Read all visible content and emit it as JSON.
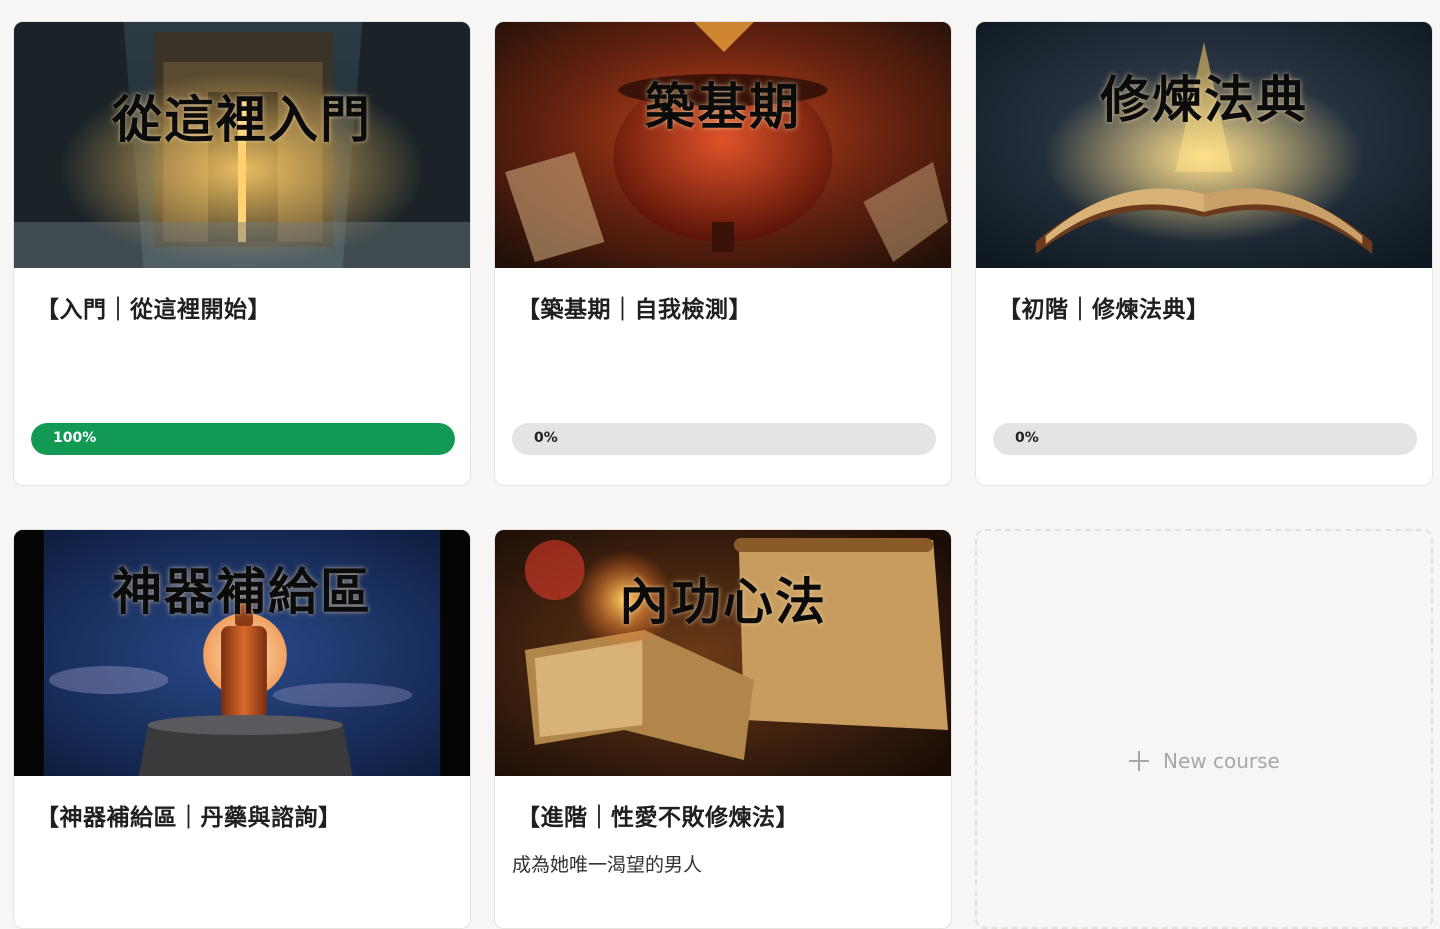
{
  "courses": [
    {
      "banner": "從這裡入門",
      "title": "【入門｜從這裡開始】",
      "subtitle": "",
      "progress_value": 1.0,
      "progress_label": "100%",
      "image": "temple-gate-image"
    },
    {
      "banner": "築基期",
      "title": "【築基期｜自我檢測】",
      "subtitle": "",
      "progress_value": 0,
      "progress_label": "0%",
      "image": "flaming-cauldron-image"
    },
    {
      "banner": "修煉法典",
      "title": "【初階｜修煉法典】",
      "subtitle": "",
      "progress_value": 0,
      "progress_label": "0%",
      "image": "glowing-book-image"
    },
    {
      "banner": "神器補給區",
      "title": "【神器補給區｜丹藥與諮詢】",
      "subtitle": "",
      "image": "potion-bottle-image"
    },
    {
      "banner": "內功心法",
      "title": "【進階｜性愛不敗修煉法】",
      "subtitle": "成為她唯一渴望的男人",
      "image": "scroll-and-book-image"
    }
  ],
  "new_course": {
    "label": "New course",
    "icon": "plus-icon"
  },
  "colors": {
    "progress_fill": "#129a55",
    "progress_track": "#e4e4e4",
    "background": "#f7f6f4"
  }
}
